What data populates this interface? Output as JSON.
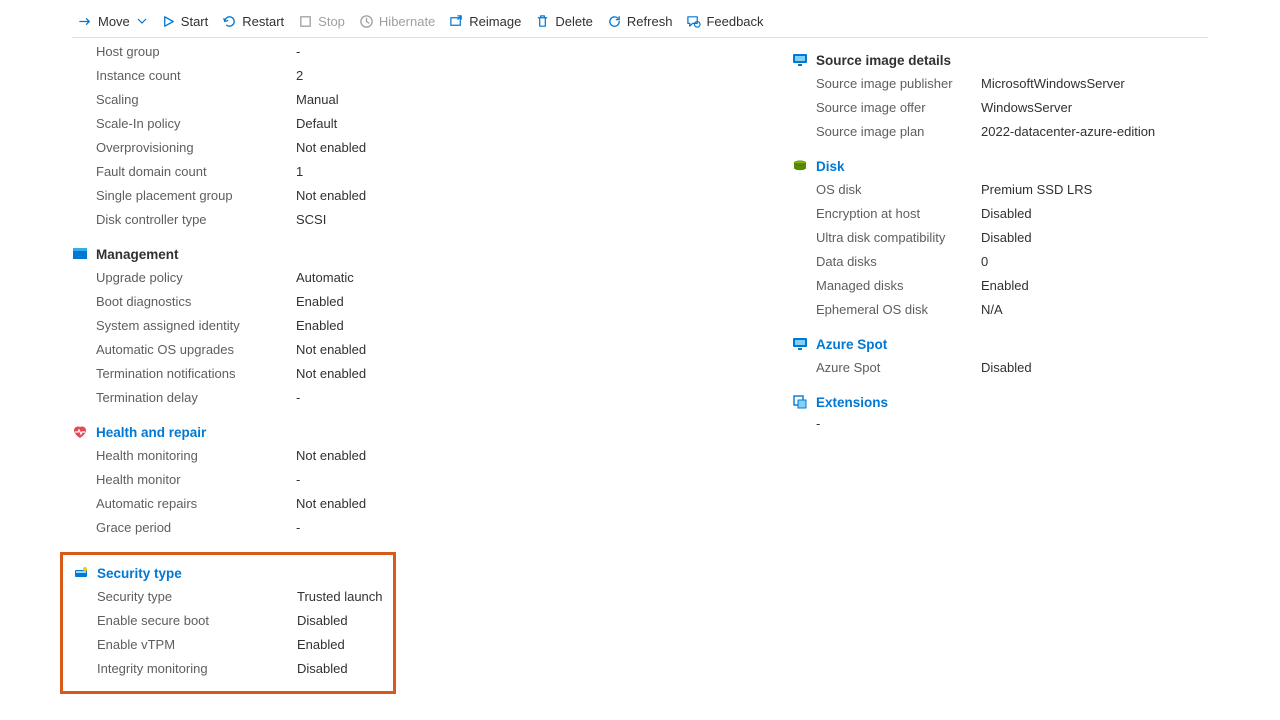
{
  "toolbar": {
    "move": "Move",
    "start": "Start",
    "restart": "Restart",
    "stop": "Stop",
    "hibernate": "Hibernate",
    "reimage": "Reimage",
    "delete": "Delete",
    "refresh": "Refresh",
    "feedback": "Feedback"
  },
  "left": {
    "basic": [
      {
        "label": "Host group",
        "value": "-"
      },
      {
        "label": "Instance count",
        "value": "2"
      },
      {
        "label": "Scaling",
        "value": "Manual"
      },
      {
        "label": "Scale-In policy",
        "value": "Default"
      },
      {
        "label": "Overprovisioning",
        "value": "Not enabled"
      },
      {
        "label": "Fault domain count",
        "value": "1"
      },
      {
        "label": "Single placement group",
        "value": "Not enabled"
      },
      {
        "label": "Disk controller type",
        "value": "SCSI"
      }
    ],
    "management": {
      "title": "Management",
      "rows": [
        {
          "label": "Upgrade policy",
          "value": "Automatic"
        },
        {
          "label": "Boot diagnostics",
          "value": "Enabled"
        },
        {
          "label": "System assigned identity",
          "value": "Enabled"
        },
        {
          "label": "Automatic OS upgrades",
          "value": "Not enabled"
        },
        {
          "label": "Termination notifications",
          "value": "Not enabled"
        },
        {
          "label": "Termination delay",
          "value": "-"
        }
      ]
    },
    "health": {
      "title": "Health and repair",
      "rows": [
        {
          "label": "Health monitoring",
          "value": "Not enabled"
        },
        {
          "label": "Health monitor",
          "value": "-"
        },
        {
          "label": "Automatic repairs",
          "value": "Not enabled"
        },
        {
          "label": "Grace period",
          "value": "-"
        }
      ]
    },
    "security": {
      "title": "Security type",
      "rows": [
        {
          "label": "Security type",
          "value": "Trusted launch"
        },
        {
          "label": "Enable secure boot",
          "value": "Disabled"
        },
        {
          "label": "Enable vTPM",
          "value": "Enabled"
        },
        {
          "label": "Integrity monitoring",
          "value": "Disabled"
        }
      ]
    }
  },
  "right": {
    "image": {
      "title": "Source image details",
      "rows": [
        {
          "label": "Source image publisher",
          "value": "MicrosoftWindowsServer"
        },
        {
          "label": "Source image offer",
          "value": "WindowsServer"
        },
        {
          "label": "Source image plan",
          "value": "2022-datacenter-azure-edition"
        }
      ]
    },
    "disk": {
      "title": "Disk",
      "rows": [
        {
          "label": "OS disk",
          "value": "Premium SSD LRS"
        },
        {
          "label": "Encryption at host",
          "value": "Disabled"
        },
        {
          "label": "Ultra disk compatibility",
          "value": "Disabled"
        },
        {
          "label": "Data disks",
          "value": "0"
        },
        {
          "label": "Managed disks",
          "value": "Enabled"
        },
        {
          "label": "Ephemeral OS disk",
          "value": "N/A"
        }
      ]
    },
    "spot": {
      "title": "Azure Spot",
      "rows": [
        {
          "label": "Azure Spot",
          "value": "Disabled"
        }
      ]
    },
    "ext": {
      "title": "Extensions",
      "value": "-"
    }
  }
}
